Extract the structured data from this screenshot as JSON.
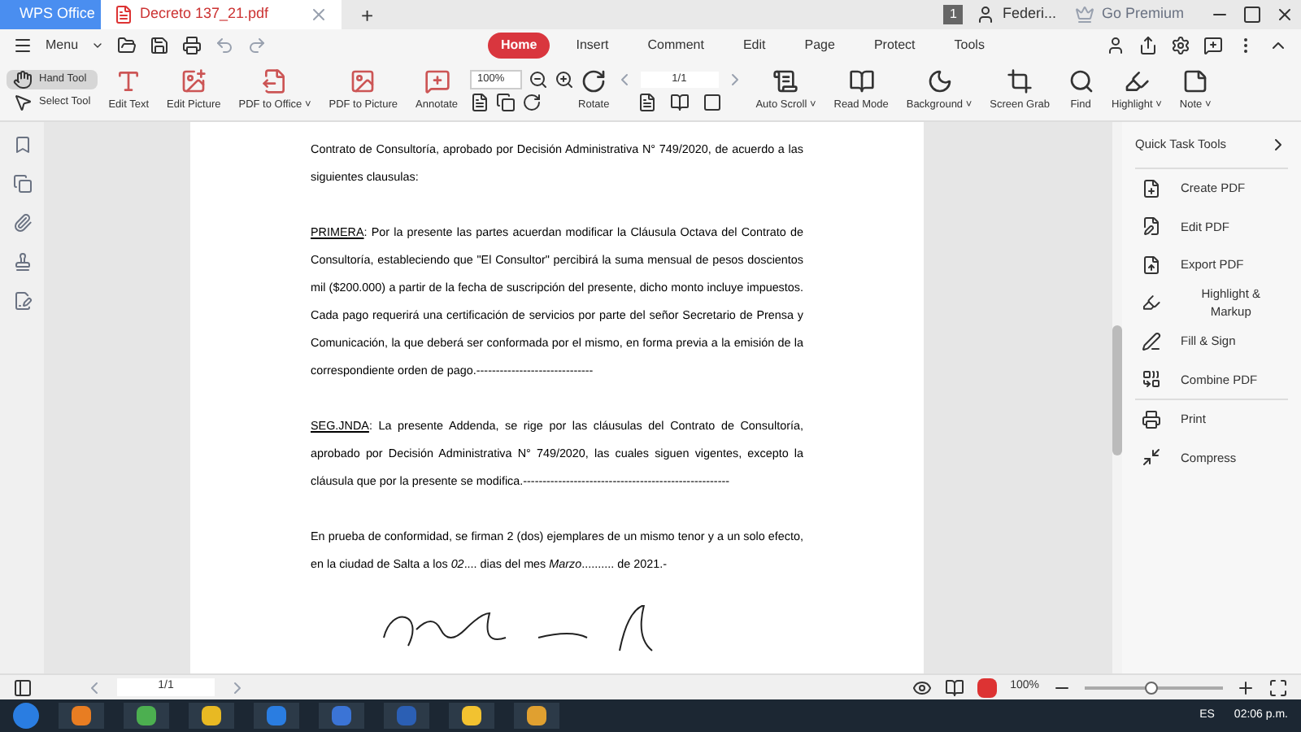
{
  "titlebar": {
    "tabs": [
      {
        "label": "WPS Office",
        "kind": "home",
        "selected": false
      },
      {
        "label": "Decreto 137_21.pdf",
        "kind": "doc",
        "selected": true
      }
    ],
    "new_tab": "+",
    "badge": "1",
    "user": "Federi...",
    "premium": "Go Premium"
  },
  "menubar": {
    "menu": "Menu",
    "tabs": [
      {
        "label": "Home",
        "selected": true
      },
      {
        "label": "Insert",
        "selected": false
      },
      {
        "label": "Comment",
        "selected": false
      },
      {
        "label": "Edit",
        "selected": false
      },
      {
        "label": "Page",
        "selected": false
      },
      {
        "label": "Protect",
        "selected": false
      },
      {
        "label": "Tools",
        "selected": false
      }
    ]
  },
  "ribbon": {
    "hand_tool": {
      "label": "Hand Tool",
      "selected": true
    },
    "select_tool": {
      "label": "Select Tool",
      "selected": false
    },
    "left_tools": [
      "Edit Text",
      "Edit Picture",
      "PDF to Office ˅",
      "PDF to Picture",
      "Annotate"
    ],
    "zoom": "100%",
    "rotate": "Rotate",
    "page": "1/1",
    "right_tools": [
      "Auto Scroll ˅",
      "Read Mode",
      "Background ˅",
      "Screen Grab",
      "Find",
      "Highlight ˅",
      "Note ˅"
    ]
  },
  "document": {
    "paragraphs": [
      {
        "text": "Contrato de Consultoría, aprobado por Decisión Administrativa N° 749/2020, de acuerdo a las siguientes clausulas:"
      },
      {
        "lead": "PRIMERA",
        "text": ": Por la presente las partes acuerdan modificar la Cláusula Octava del Contrato de Consultoría, estableciendo que \"El Consultor\" percibirá la suma mensual de pesos doscientos mil ($200.000) a partir de la fecha de suscripción del presente, dicho monto incluye impuestos. Cada pago requerirá una certificación de servicios por parte del señor Secretario de Prensa y Comunicación, la que deberá ser conformada por el mismo, en forma previa a la emisión de la correspondiente orden de pago.------------------------------"
      },
      {
        "lead": "SEG.JNDA",
        "text": ": La presente Addenda, se rige por las cláusulas del Contrato de Consultoría, aprobado por Decisión Administrativa N° 749/2020, las cuales siguen vigentes, excepto la cláusula que por la presente se modifica.-----------------------------------------------------"
      },
      {
        "text": "En prueba de conformidad, se firman 2 (dos) ejemplares de un mismo tenor y a un solo efecto, en la ciudad de Salta a los *02*.... dias del mes *Marzo*.......... de 2021.-"
      }
    ]
  },
  "quick_panel": {
    "title": "Quick Task Tools",
    "items": [
      "Create PDF",
      "Edit PDF",
      "Export PDF",
      "Highlight & Markup",
      "Fill & Sign",
      "Combine PDF",
      "Print",
      "Compress"
    ]
  },
  "statusbar": {
    "page": "1/1",
    "zoom": "100%",
    "zoom_slider": {
      "level": 0.48
    }
  },
  "taskbar": {
    "language": "ES",
    "time": "02:06 p.m."
  }
}
